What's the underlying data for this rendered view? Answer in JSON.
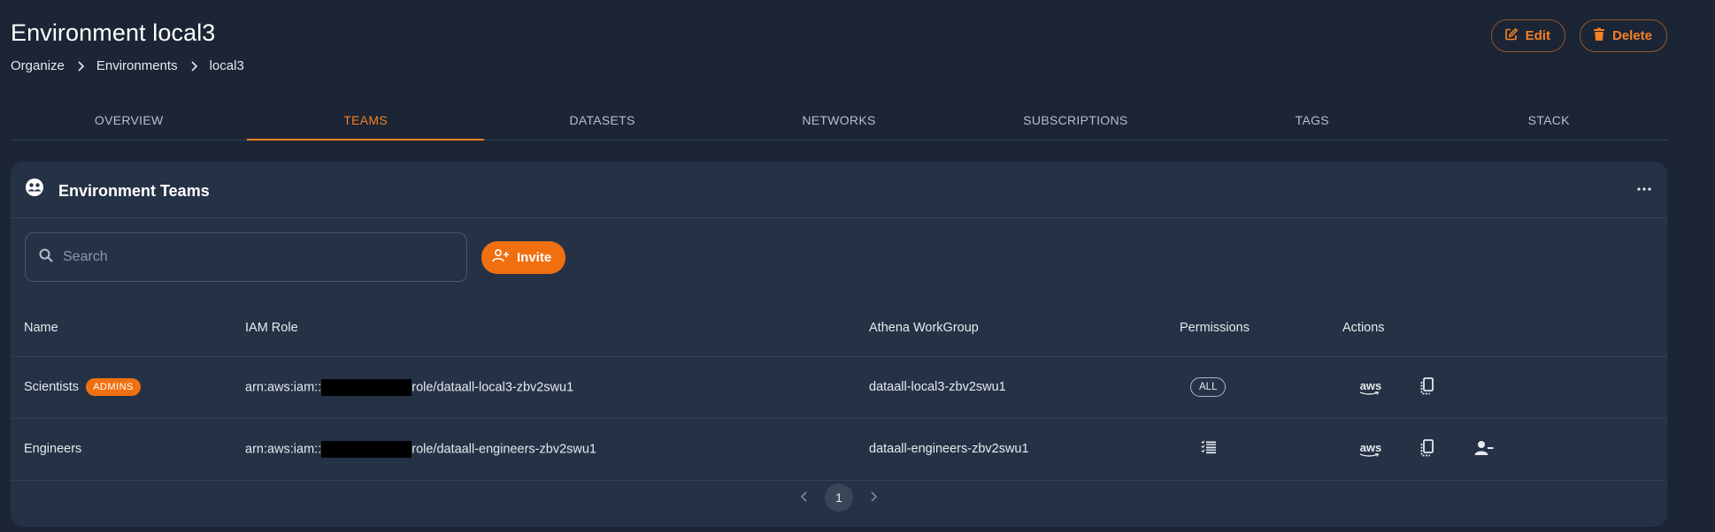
{
  "page": {
    "title": "Environment local3"
  },
  "breadcrumb": [
    "Organize",
    "Environments",
    "local3"
  ],
  "header_actions": {
    "edit_label": "Edit",
    "delete_label": "Delete"
  },
  "tabs": [
    {
      "label": "OVERVIEW",
      "active": false
    },
    {
      "label": "TEAMS",
      "active": true
    },
    {
      "label": "DATASETS",
      "active": false
    },
    {
      "label": "NETWORKS",
      "active": false
    },
    {
      "label": "SUBSCRIPTIONS",
      "active": false
    },
    {
      "label": "TAGS",
      "active": false
    },
    {
      "label": "STACK",
      "active": false
    }
  ],
  "card": {
    "title": "Environment Teams"
  },
  "search": {
    "placeholder": "Search",
    "value": ""
  },
  "invite": {
    "label": "Invite"
  },
  "table": {
    "headers": {
      "name": "Name",
      "iam_role": "IAM Role",
      "workgroup": "Athena WorkGroup",
      "permissions": "Permissions",
      "actions": "Actions"
    },
    "rows": [
      {
        "name": "Scientists",
        "badge": "ADMINS",
        "iam_prefix": "arn:aws:iam::",
        "iam_suffix": "role/dataall-local3-zbv2swu1",
        "workgroup": "dataall-local3-zbv2swu1",
        "permissions": "ALL"
      },
      {
        "name": "Engineers",
        "iam_prefix": "arn:aws:iam::",
        "iam_suffix": "role/dataall-engineers-zbv2swu1",
        "workgroup": "dataall-engineers-zbv2swu1",
        "permissions_icon": "list-checks-icon"
      }
    ]
  },
  "aws_logo_text": "aws",
  "pagination": {
    "current": "1"
  },
  "colors": {
    "accent": "#f58025",
    "background": "#1b2535",
    "card": "#253246"
  }
}
